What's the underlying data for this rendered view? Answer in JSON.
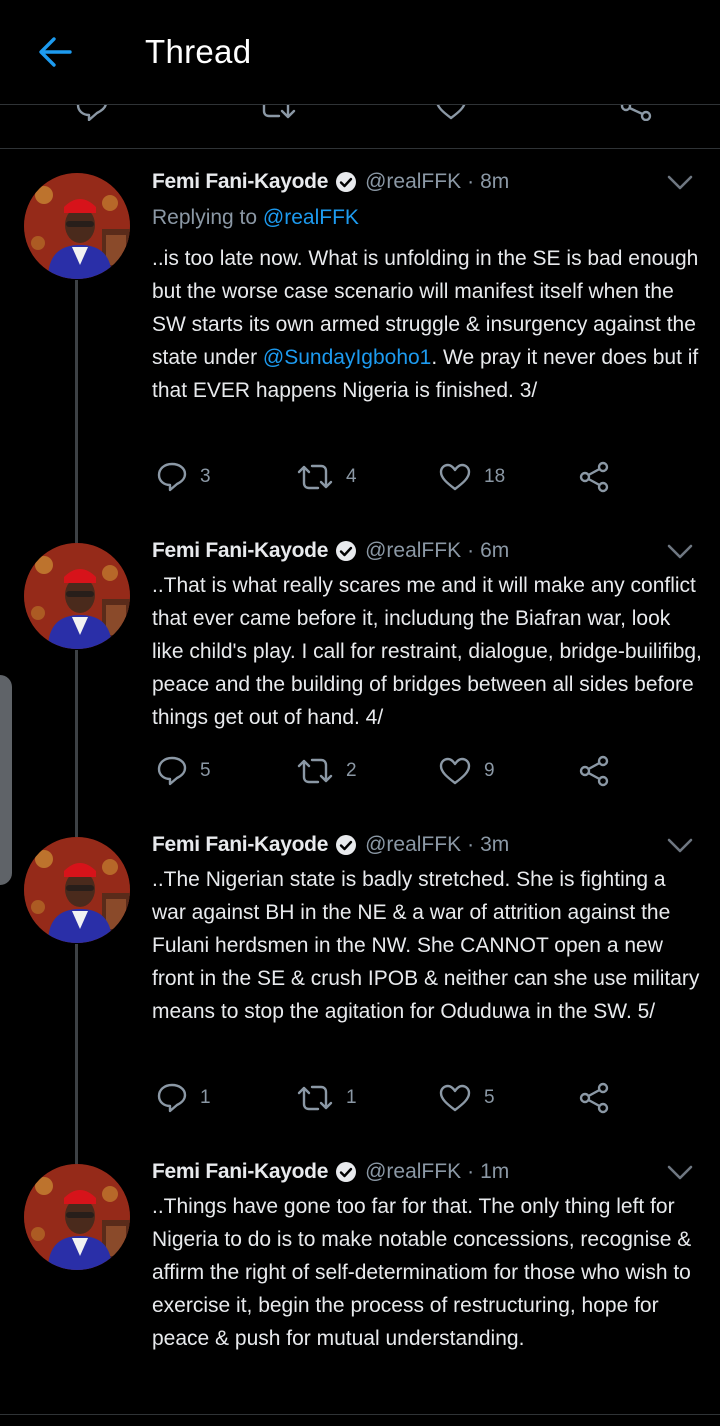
{
  "header": {
    "title": "Thread",
    "back_icon": "arrow-left-icon"
  },
  "colors": {
    "background": "#000000",
    "text_primary": "#e8eaed",
    "text_secondary": "#8b98a5",
    "accent": "#1d9bf0",
    "divider": "#2f3336"
  },
  "tweets": [
    {
      "author": "Femi Fani-Kayode",
      "handle": "@realFFK",
      "separator": "·",
      "time": "8m",
      "reply_prefix": "Replying to",
      "reply_to": "@realFFK",
      "text_before": "..is too late now. What is unfolding in the SE is bad enough but the worse case scenario will manifest itself when the SW starts its own armed struggle & insurgency against the state under ",
      "mention": "@SundayIgboho1",
      "text_after": ". We pray it never does but if that EVER happens Nigeria is finished. 3/",
      "replies": "3",
      "retweets": "4",
      "likes": "18"
    },
    {
      "author": "Femi Fani-Kayode",
      "handle": "@realFFK",
      "separator": "·",
      "time": "6m",
      "text": "..That is what really scares me and it will make any conflict that ever came before it, includung the Biafran war, look like child's play. I call for restraint, dialogue, bridge-builifibg, peace and the building of bridges between all sides before things get out of hand. 4/",
      "replies": "5",
      "retweets": "2",
      "likes": "9"
    },
    {
      "author": "Femi Fani-Kayode",
      "handle": "@realFFK",
      "separator": "·",
      "time": "3m",
      "text": "..The Nigerian state is badly stretched. She is fighting a war against BH in the NE & a war of attrition against the Fulani herdsmen in the NW. She CANNOT open a new front in the SE & crush IPOB & neither can she use military means to stop the agitation for Oduduwa in the SW. 5/",
      "replies": "1",
      "retweets": "1",
      "likes": "5"
    },
    {
      "author": "Femi Fani-Kayode",
      "handle": "@realFFK",
      "separator": "·",
      "time": "1m",
      "text": "..Things have gone too far for that. The only thing left for Nigeria to do is to make notable concessions, recognise & affirm the right of self-determinatiom for those who wish to exercise it, begin the process of restructuring, hope for peace & push for mutual understanding."
    }
  ]
}
